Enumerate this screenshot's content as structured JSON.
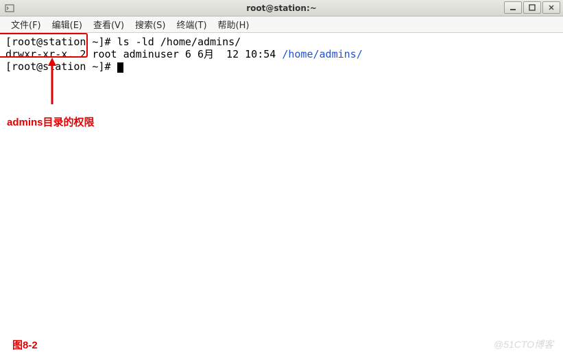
{
  "titlebar": {
    "title": "root@station:~"
  },
  "menubar": {
    "items": [
      "文件(F)",
      "编辑(E)",
      "查看(V)",
      "搜索(S)",
      "终端(T)",
      "帮助(H)"
    ]
  },
  "terminal": {
    "line1_prompt": "[root@station ~]# ",
    "line1_cmd": "ls -ld /home/admins/",
    "line2_perm": "drwxr-xr-x.",
    "line2_mid": " 2 root adminuser 6 6月  12 10:54 ",
    "line2_path": "/home/admins/",
    "line3_prompt": "[root@station ~]# "
  },
  "annotations": {
    "perm_label": "admins目录的权限",
    "figure_label": "图8-2",
    "watermark": "@51CTO博客"
  }
}
